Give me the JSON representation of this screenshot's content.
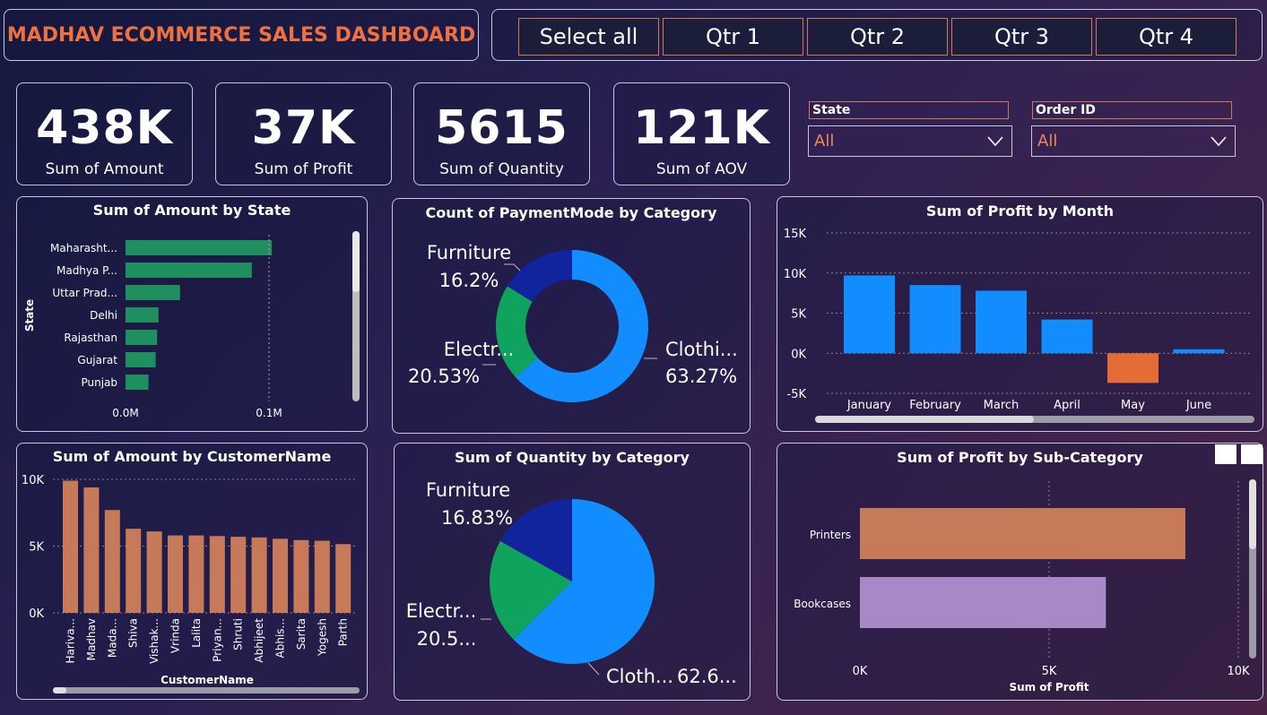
{
  "header": {
    "title": "MADHAV ECOMMERCE SALES DASHBOARD"
  },
  "slicer": {
    "buttons": [
      "Select all",
      "Qtr 1",
      "Qtr 2",
      "Qtr 3",
      "Qtr 4"
    ]
  },
  "kpis": [
    {
      "value": "438K",
      "label": "Sum of Amount"
    },
    {
      "value": "37K",
      "label": "Sum of Profit"
    },
    {
      "value": "5615",
      "label": "Sum of Quantity"
    },
    {
      "value": "121K",
      "label": "Sum of AOV"
    }
  ],
  "filters": {
    "state": {
      "label": "State",
      "value": "All"
    },
    "order": {
      "label": "Order ID",
      "value": "All"
    }
  },
  "colors": {
    "accent": "#ee7140",
    "green": "#1f8f5f",
    "blue": "#118dff",
    "darkblue": "#12239e",
    "teal": "#0fa35d",
    "salmon": "#c77a5a",
    "orange": "#e66c37",
    "lavender": "#a889c8"
  },
  "chart_data": [
    {
      "type": "bar",
      "orientation": "horizontal",
      "title": "Sum of Amount by State",
      "ylabel": "State",
      "categories": [
        "Maharasht...",
        "Madhya P...",
        "Uttar Prad...",
        "Delhi",
        "Rajasthan",
        "Gujarat",
        "Punjab"
      ],
      "values": [
        0.102,
        0.088,
        0.038,
        0.023,
        0.022,
        0.021,
        0.016
      ],
      "xticks": [
        "0.0M",
        "0.1M"
      ],
      "xlim": [
        0,
        0.1
      ]
    },
    {
      "type": "pie",
      "variant": "donut",
      "title": "Count of PaymentMode by Category",
      "slices": [
        {
          "name": "Clothi...",
          "label": "63.27%",
          "value": 63.27
        },
        {
          "name": "Electr...",
          "label": "20.53%",
          "value": 20.53
        },
        {
          "name": "Furniture",
          "label": "16.2%",
          "value": 16.2
        }
      ]
    },
    {
      "type": "bar",
      "title": "Sum of Profit by Month",
      "categories": [
        "January",
        "February",
        "March",
        "April",
        "May",
        "June"
      ],
      "values": [
        9700,
        8500,
        7800,
        4200,
        -3700,
        500
      ],
      "yticks": [
        "15K",
        "10K",
        "5K",
        "0K",
        "-5K"
      ],
      "ylim": [
        -5000,
        15000
      ]
    },
    {
      "type": "bar",
      "title": "Sum of Amount by CustomerName",
      "xlabel": "CustomerName",
      "categories": [
        "Hariva...",
        "Madhav",
        "Mada...",
        "Shiva",
        "Vishak...",
        "Vrinda",
        "Lalita",
        "Priyan...",
        "Shruti",
        "Abhijeet",
        "Abhis...",
        "Sarita",
        "Yogesh",
        "Parth"
      ],
      "values": [
        9900,
        9400,
        7700,
        6300,
        6100,
        5800,
        5800,
        5750,
        5700,
        5650,
        5550,
        5450,
        5400,
        5150
      ],
      "yticks": [
        "10K",
        "5K",
        "0K"
      ],
      "ylim": [
        0,
        10000
      ]
    },
    {
      "type": "pie",
      "title": "Sum of Quantity by Category",
      "slices": [
        {
          "name": "Cloth...",
          "label": "62.6...",
          "value": 62.6
        },
        {
          "name": "Electr...",
          "label": "20.5...",
          "value": 20.57
        },
        {
          "name": "Furniture",
          "label": "16.83%",
          "value": 16.83
        }
      ]
    },
    {
      "type": "bar",
      "orientation": "horizontal",
      "title": "Sum of Profit by Sub-Category",
      "xlabel": "Sum of Profit",
      "categories": [
        "Printers",
        "Bookcases"
      ],
      "values": [
        8600,
        6500
      ],
      "xticks": [
        "0K",
        "5K",
        "10K"
      ],
      "xlim": [
        0,
        10000
      ]
    }
  ]
}
